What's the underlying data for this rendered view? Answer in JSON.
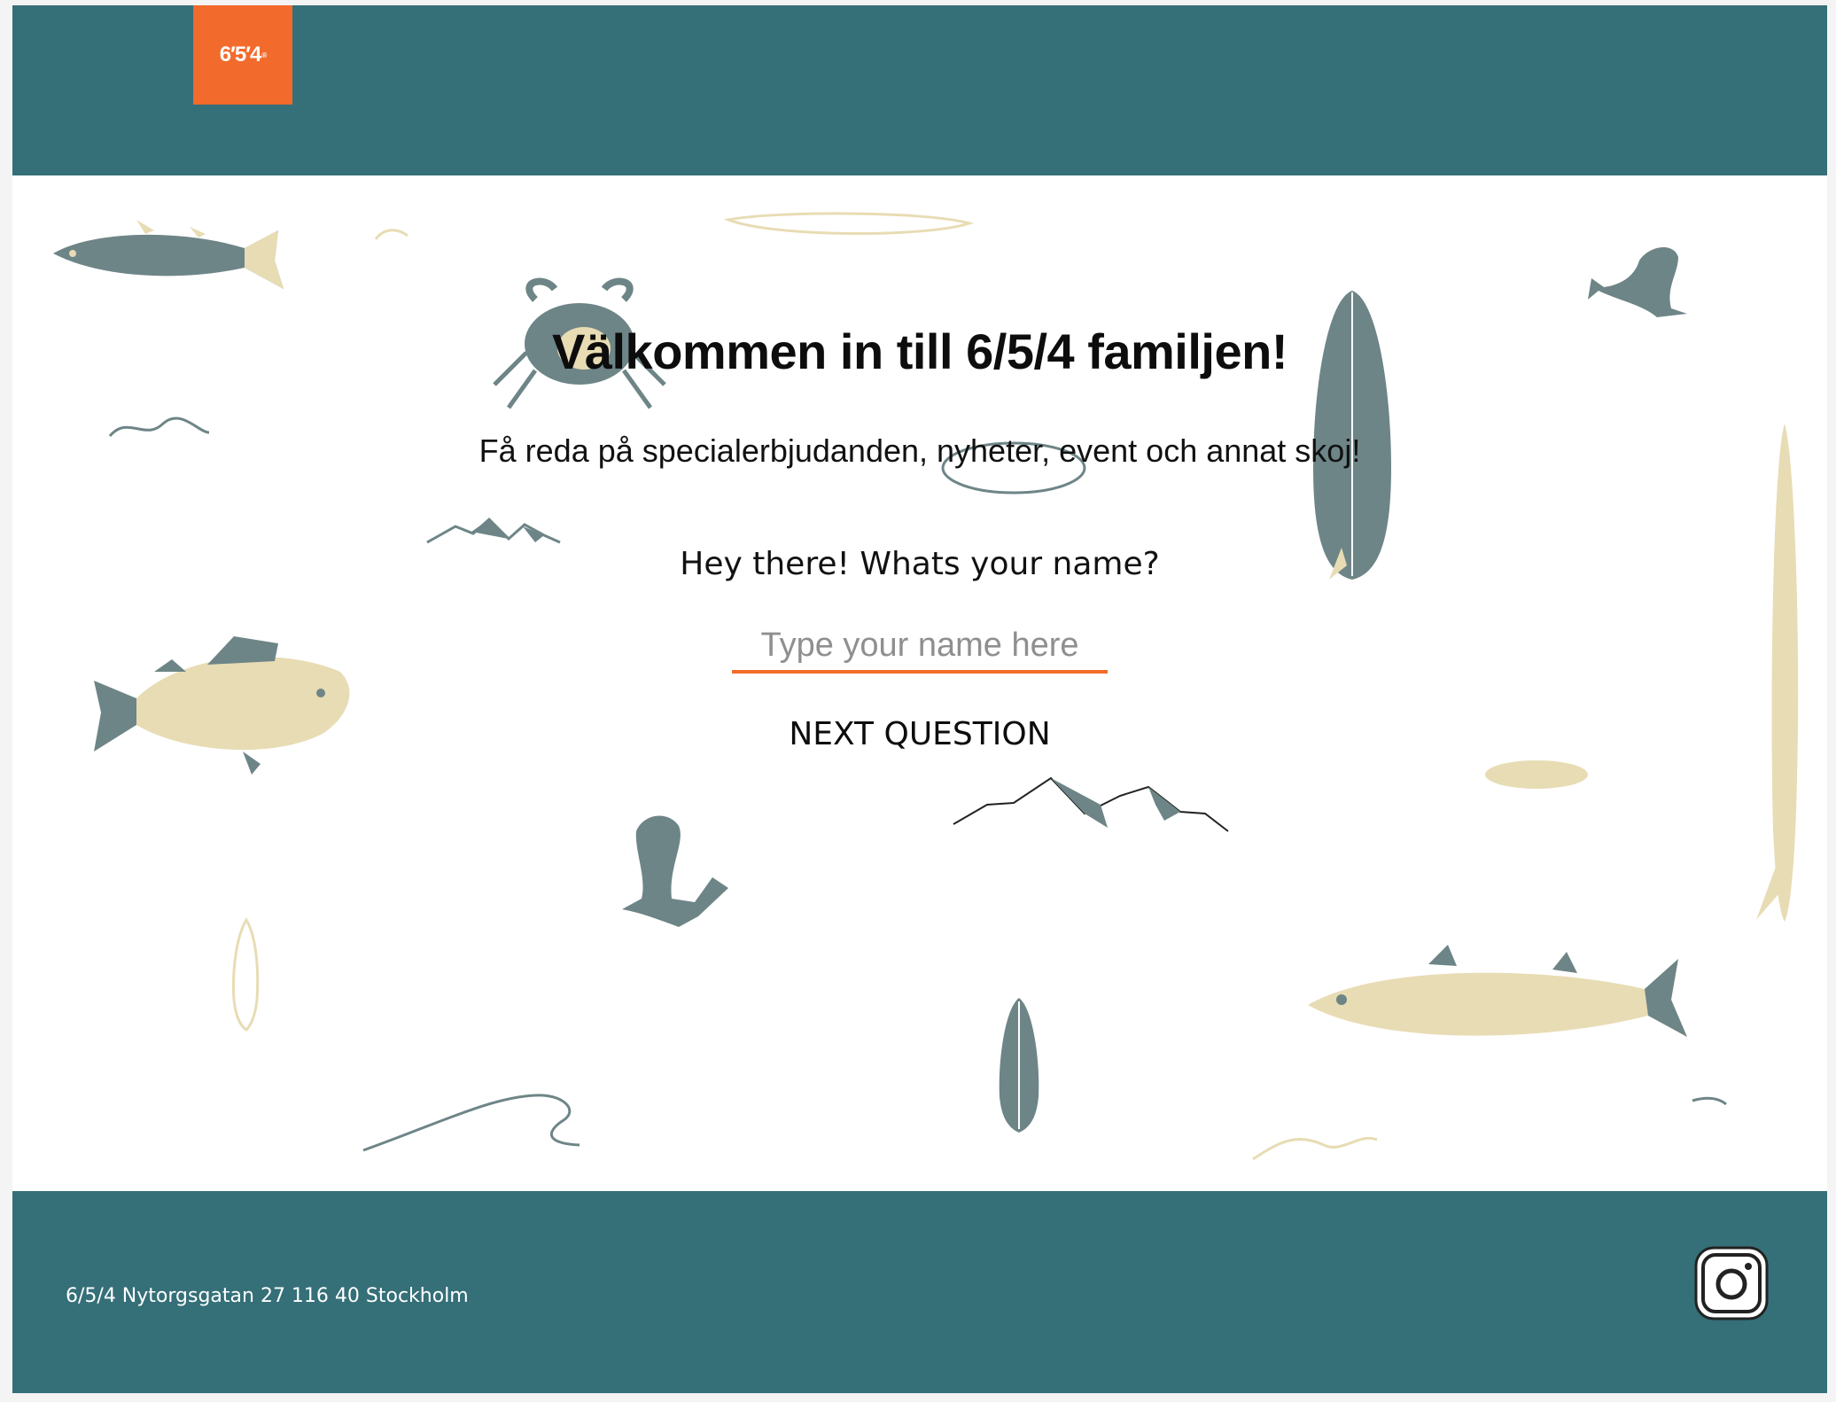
{
  "header": {
    "logo_text": "6′5′4",
    "logo_mark": "®"
  },
  "main": {
    "title": "Välkommen in till 6/5/4 familjen!",
    "subtitle": "Få reda på specialerbjudanden, nyheter, event och annat skoj!",
    "question": "Hey there! Whats your name?",
    "name_input": {
      "value": "",
      "placeholder": "Type your name here"
    },
    "next_button_label": "NEXT QUESTION"
  },
  "footer": {
    "address": "6/5/4 Nytorgsgatan 27 116 40 Stockholm",
    "social_icon": "instagram-icon"
  },
  "colors": {
    "brand_teal": "#356f78",
    "accent_orange": "#f26a2c",
    "deco_slate": "#6e8587",
    "deco_sand": "#e8dcb4"
  }
}
